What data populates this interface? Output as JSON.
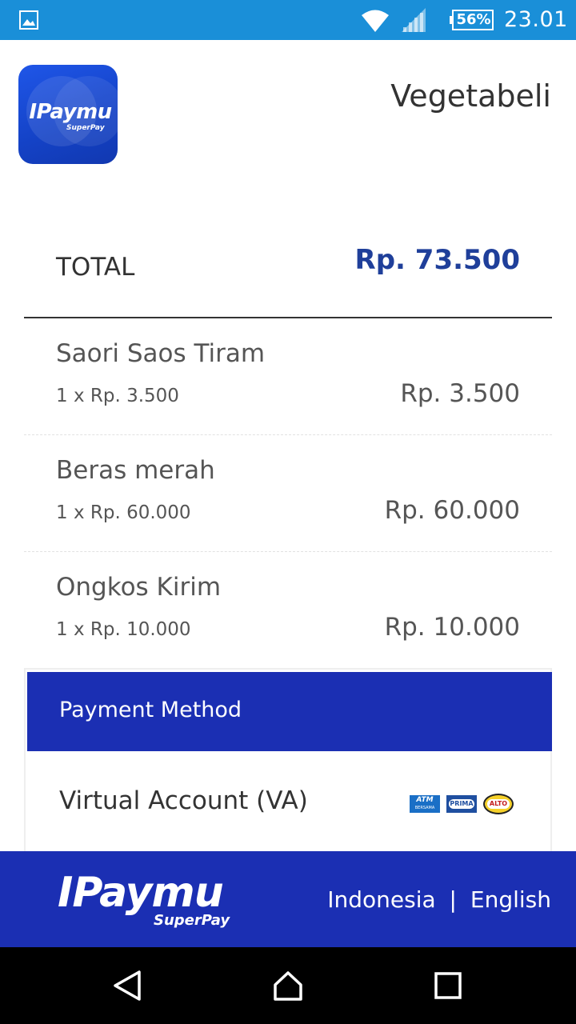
{
  "status_bar": {
    "battery": "56%",
    "time": "23.01"
  },
  "app_logo": {
    "text": "IPaymu",
    "sub": "SuperPay"
  },
  "merchant_name": "Vegetabeli",
  "total": {
    "label": "TOTAL",
    "value": "Rp. 73.500"
  },
  "items": [
    {
      "name": "Saori Saos Tiram",
      "qty_price": "1 x Rp. 3.500",
      "price": "Rp. 3.500"
    },
    {
      "name": "Beras merah",
      "qty_price": "1 x Rp. 60.000",
      "price": "Rp. 60.000"
    },
    {
      "name": "Ongkos Kirim",
      "qty_price": "1 x Rp. 10.000",
      "price": "Rp. 10.000"
    }
  ],
  "payment": {
    "header": "Payment Method",
    "va_label": "Virtual Account (VA)",
    "banks": {
      "atm": "ATM",
      "atm_sub": "BERSAMA",
      "prima": "PRIMA",
      "alto": "ALTO"
    }
  },
  "footer": {
    "logo": "IPaymu",
    "logo_sub": "SuperPay",
    "lang_id": "Indonesia",
    "separator": "|",
    "lang_en": "English"
  },
  "colors": {
    "status_bar": "#1a8fd8",
    "primary": "#1b2fb3",
    "total_value": "#1f3f9a"
  }
}
